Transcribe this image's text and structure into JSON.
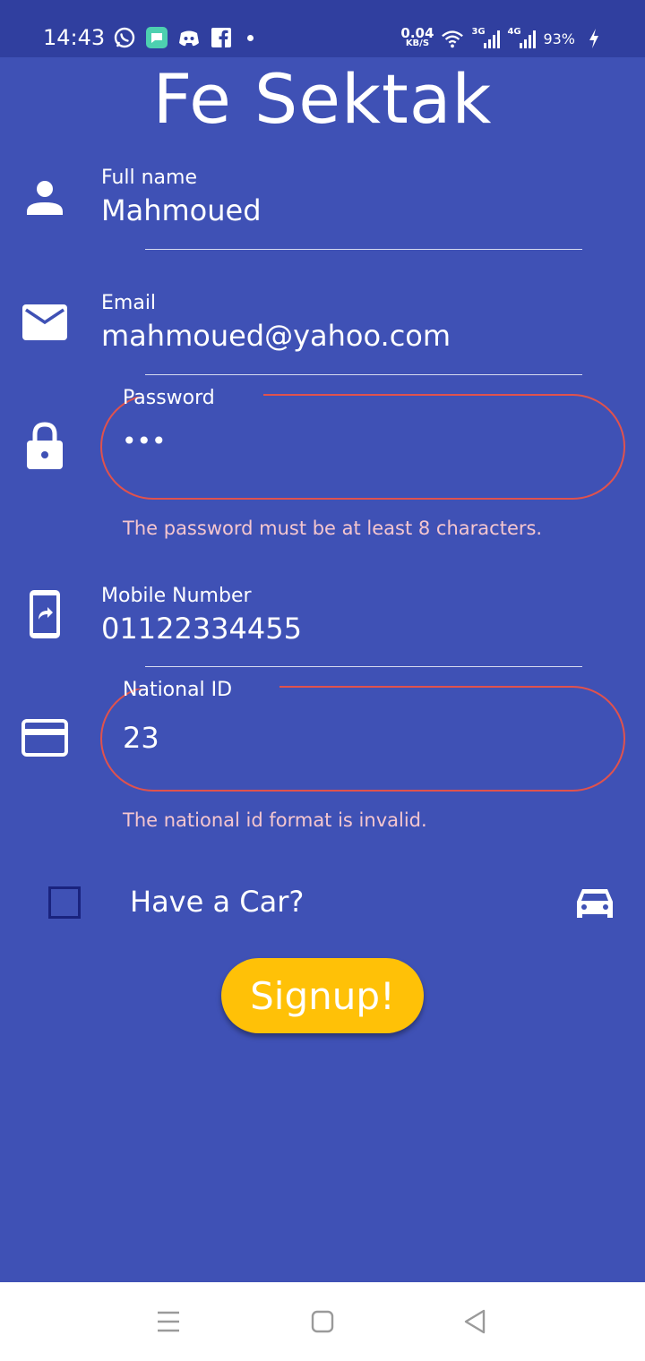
{
  "status_bar": {
    "time": "14:43",
    "net_speed_value": "0.04",
    "net_speed_unit": "KB/S",
    "signal1_label": "3G",
    "signal2_label": "4G",
    "battery": "93%",
    "left_icons": [
      "whatsapp-icon",
      "messages-icon",
      "discord-icon",
      "facebook-icon"
    ]
  },
  "app": {
    "title": "Fe Sektak"
  },
  "form": {
    "full_name": {
      "label": "Full name",
      "value": "Mahmoued"
    },
    "email": {
      "label": "Email",
      "value": "mahmoued@yahoo.com"
    },
    "password": {
      "label": "Password",
      "value": "•••",
      "error": "The password must be at least 8 characters."
    },
    "mobile": {
      "label": "Mobile Number",
      "value": "01122334455"
    },
    "national_id": {
      "label": "National ID",
      "value": "23",
      "error": "The national id format is invalid."
    },
    "have_car": {
      "label": "Have a Car?",
      "checked": false
    },
    "signup_label": "Signup!"
  },
  "colors": {
    "background": "#3F51B5",
    "status_bar": "#303F9F",
    "accent_button": "#FFC107",
    "error": "#E0524D",
    "error_text": "#F5C6CF"
  },
  "nav": {
    "icons": [
      "menu-icon",
      "home-icon",
      "back-icon"
    ]
  }
}
